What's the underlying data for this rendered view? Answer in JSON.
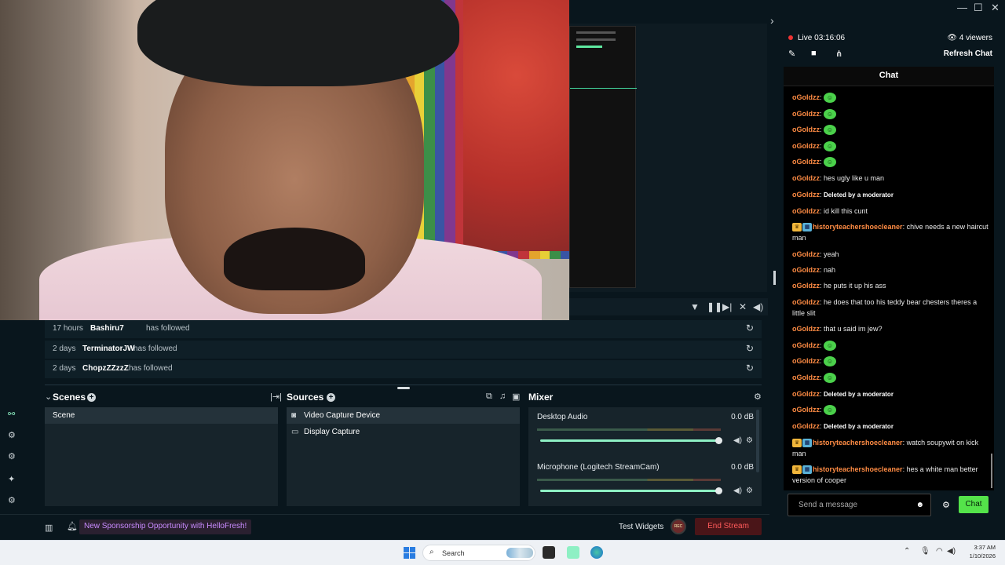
{
  "stream": {
    "status": "Live",
    "timer": "03:16:06",
    "viewers": "4 viewers",
    "refresh_chat": "Refresh Chat"
  },
  "events": [
    {
      "time": "17 hours",
      "user": "Bashiru7",
      "action": "has followed"
    },
    {
      "time": "2 days",
      "user": "TerminatorJW",
      "action": "has followed"
    },
    {
      "time": "2 days",
      "user": "ChopzZZzzZ",
      "action": "has followed"
    }
  ],
  "scenes": {
    "title": "Scenes",
    "items": [
      "Scene"
    ]
  },
  "sources": {
    "title": "Sources",
    "items": [
      "Video Capture Device",
      "Display Capture"
    ]
  },
  "mixer": {
    "title": "Mixer",
    "channels": [
      {
        "name": "Desktop Audio",
        "db": "0.0 dB"
      },
      {
        "name": "Microphone (Logitech StreamCam)",
        "db": "0.0 dB"
      }
    ]
  },
  "footer": {
    "sponsorship": "New Sponsorship Opportunity with HelloFresh!",
    "test_widgets": "Test Widgets",
    "rec": "REC",
    "end_stream": "End Stream"
  },
  "chat": {
    "title": "Chat",
    "placeholder": "Send a message",
    "send": "Chat",
    "messages": [
      {
        "user": "oGoldzz",
        "text": "",
        "emote": true
      },
      {
        "user": "oGoldzz",
        "text": "",
        "emote": true
      },
      {
        "user": "oGoldzz",
        "text": "",
        "emote": true
      },
      {
        "user": "oGoldzz",
        "text": "",
        "emote": true
      },
      {
        "user": "oGoldzz",
        "text": "",
        "emote": true
      },
      {
        "user": "oGoldzz",
        "text": "hes ugly like u man"
      },
      {
        "user": "oGoldzz",
        "text": "Deleted by a moderator",
        "deleted": true
      },
      {
        "user": "oGoldzz",
        "text": "id kill this cunt"
      },
      {
        "user": "historyteachershoecleaner",
        "text": "chive needs a new haircut man",
        "badges": true
      },
      {
        "user": "oGoldzz",
        "text": "yeah"
      },
      {
        "user": "oGoldzz",
        "text": "nah"
      },
      {
        "user": "oGoldzz",
        "text": "he puts it up his ass"
      },
      {
        "user": "oGoldzz",
        "text": "he does that too his teddy bear chesters theres a little slit"
      },
      {
        "user": "oGoldzz",
        "text": "that u said im jew?"
      },
      {
        "user": "oGoldzz",
        "text": "",
        "emote": true
      },
      {
        "user": "oGoldzz",
        "text": "",
        "emote": true
      },
      {
        "user": "oGoldzz",
        "text": "",
        "emote": true
      },
      {
        "user": "oGoldzz",
        "text": "Deleted by a moderator",
        "deleted": true
      },
      {
        "user": "oGoldzz",
        "text": "",
        "emote": true
      },
      {
        "user": "oGoldzz",
        "text": "Deleted by a moderator",
        "deleted": true
      },
      {
        "user": "historyteachershoecleaner",
        "text": "watch soupywit on kick man",
        "badges": true
      },
      {
        "user": "historyteachershoecleaner",
        "text": "hes a white man better version of cooper",
        "badges": true
      }
    ]
  },
  "taskbar": {
    "search": "Search",
    "time": "3:37 AM",
    "date": "1/10/2026"
  },
  "colors": {
    "accent": "#8ef0c4",
    "chat_button": "#54e34a",
    "username": "#ff8c44",
    "end_stream": "#ff5a5a"
  }
}
